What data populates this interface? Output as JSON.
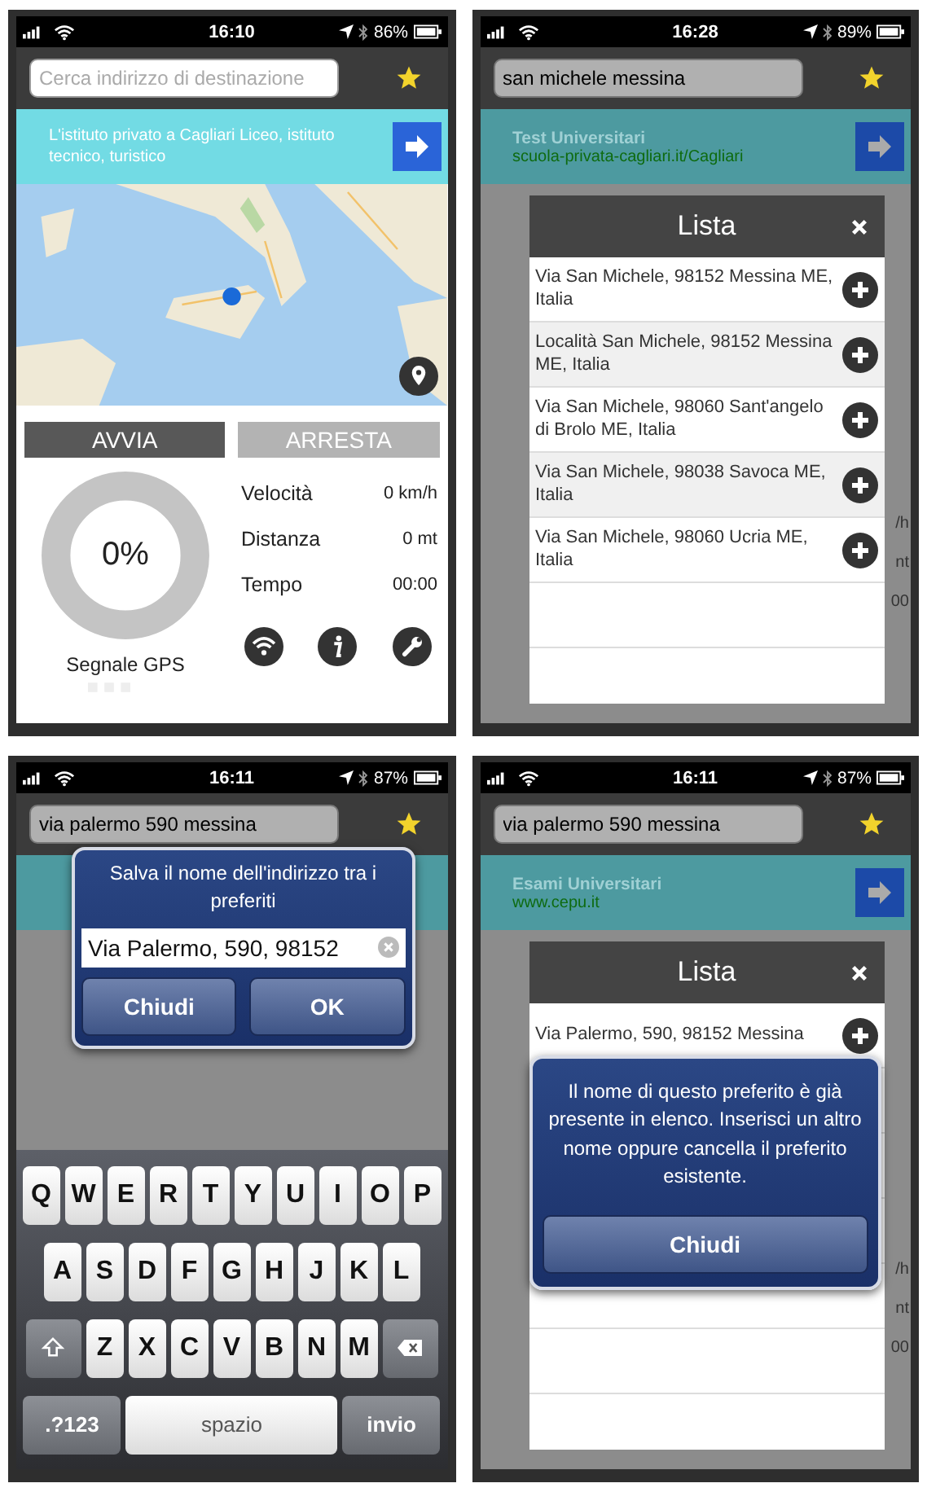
{
  "screens": [
    {
      "kind": "tracker",
      "status": {
        "time": "16:10",
        "battery": "86%"
      },
      "search": {
        "placeholder": "Cerca indirizzo di destinazione"
      },
      "ad": {
        "text": "L'istituto privato a Cagliari Liceo, istituto tecnico, turistico"
      },
      "buttons": [
        {
          "label": "AVVIA",
          "enabled": true
        },
        {
          "label": "ARRESTA",
          "enabled": false
        }
      ],
      "gauge": {
        "reading": "0%",
        "caption": "Segnale GPS"
      },
      "stats": [
        {
          "label": "Velocità",
          "value": "0 km/h"
        },
        {
          "label": "Distanza",
          "value": "0 mt"
        },
        {
          "label": "Tempo",
          "value": "00:00"
        }
      ]
    },
    {
      "kind": "list",
      "status": {
        "time": "16:28",
        "battery": "89%"
      },
      "search": {
        "value": "san michele messina"
      },
      "ad": {
        "title": "Test Universitari",
        "url": "scuola-privata-cagliari.it/Cagliari"
      },
      "list": {
        "title": "Lista",
        "items": [
          {
            "text": "Via San Michele, 98152 Messina ME, Italia"
          },
          {
            "text": "Località San Michele, 98152 Messina ME, Italia"
          },
          {
            "text": "Via San Michele, 98060 Sant'angelo di Brolo ME, Italia"
          },
          {
            "text": "Via San Michele, 98038 Savoca ME, Italia"
          },
          {
            "text": "Via San Michele, 98060 Ucria ME, Italia"
          }
        ]
      },
      "fragments": [
        "/h",
        "nt",
        "00"
      ]
    },
    {
      "kind": "save",
      "status": {
        "time": "16:11",
        "battery": "87%"
      },
      "search": {
        "value": "via palermo 590 messina"
      },
      "dialog": {
        "title": "Salva il nome dell'indirizzo tra i preferiti",
        "value": "Via Palermo, 590, 98152",
        "buttons": [
          "Chiudi",
          "OK"
        ]
      },
      "keyboard": {
        "rows": [
          [
            "Q",
            "W",
            "E",
            "R",
            "T",
            "Y",
            "U",
            "I",
            "O",
            "P"
          ],
          [
            "A",
            "S",
            "D",
            "F",
            "G",
            "H",
            "J",
            "K",
            "L"
          ],
          [
            "Z",
            "X",
            "C",
            "V",
            "B",
            "N",
            "M"
          ]
        ],
        "keys": [
          ".?123",
          "spazio",
          "invio"
        ]
      }
    },
    {
      "kind": "alert",
      "status": {
        "time": "16:11",
        "battery": "87%"
      },
      "search": {
        "value": "via palermo 590 messina"
      },
      "ad": {
        "title": "Esami Universitari",
        "url": "www.cepu.it"
      },
      "list": {
        "title": "Lista",
        "items": [
          {
            "text": "Via Palermo, 590, 98152 Messina"
          }
        ]
      },
      "alert": {
        "message": "Il nome di questo preferito è già presente in elenco. Inserisci un altro nome oppure cancella il preferito esistente.",
        "button": "Chiudi"
      },
      "fragments": [
        "/h",
        "nt",
        "00"
      ]
    }
  ]
}
